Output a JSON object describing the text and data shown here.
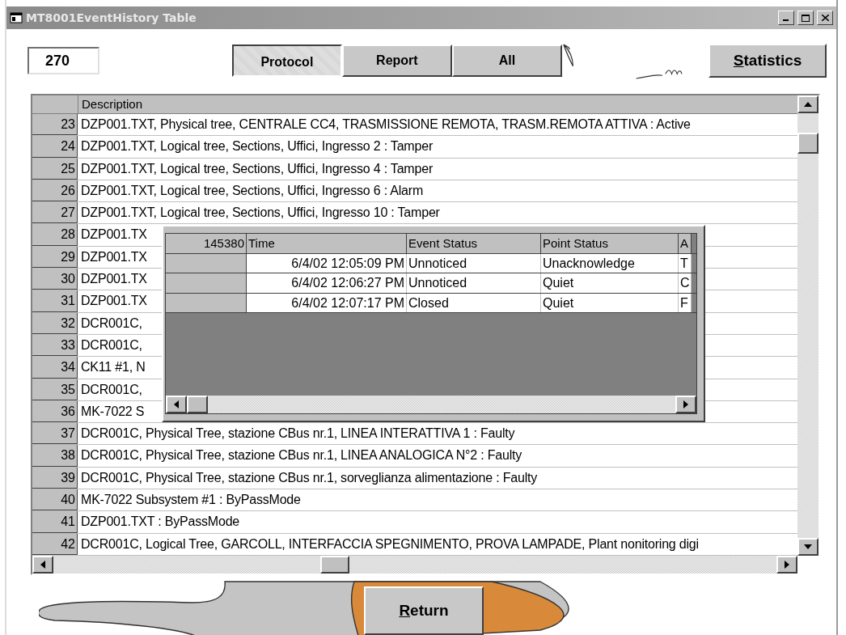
{
  "window": {
    "title": "MT8001EventHistory Table"
  },
  "counter": "270",
  "tabs": [
    {
      "label": "Protocol",
      "selected": true
    },
    {
      "label": "Report",
      "selected": false
    },
    {
      "label": "All",
      "selected": false
    }
  ],
  "statistics_button": {
    "label_parts": [
      {
        "text": "S",
        "underlined": true
      },
      {
        "text": "tatistics",
        "underlined": false
      }
    ]
  },
  "table": {
    "columns": [
      "Description"
    ],
    "rows": [
      {
        "number": "23",
        "description": "DZP001.TXT, Physical tree, CENTRALE CC4, TRASMISSIONE REMOTA, TRASM.REMOTA ATTIVA : Active"
      },
      {
        "number": "24",
        "description": "DZP001.TXT, Logical tree, Sections, Uffici, Ingresso 2 : Tamper"
      },
      {
        "number": "25",
        "description": "DZP001.TXT, Logical tree, Sections, Uffici, Ingresso 4 : Tamper"
      },
      {
        "number": "26",
        "description": "DZP001.TXT, Logical tree, Sections, Uffici, Ingresso 6 : Alarm"
      },
      {
        "number": "27",
        "description": "DZP001.TXT, Logical tree, Sections, Uffici, Ingresso 10 : Tamper"
      },
      {
        "number": "28",
        "description": "DZP001.TX"
      },
      {
        "number": "29",
        "description": "DZP001.TX"
      },
      {
        "number": "30",
        "description": "DZP001.TX"
      },
      {
        "number": "31",
        "description": "DZP001.TX"
      },
      {
        "number": "32",
        "description": "DCR001C,"
      },
      {
        "number": "33",
        "description": "DCR001C,"
      },
      {
        "number": "34",
        "description": "CK11 #1, N"
      },
      {
        "number": "35",
        "description": "DCR001C,"
      },
      {
        "number": "36",
        "description": "MK-7022 S"
      },
      {
        "number": "37",
        "description": "DCR001C, Physical Tree, stazione CBus nr.1, LINEA INTERATTIVA 1 : Faulty"
      },
      {
        "number": "38",
        "description": "DCR001C, Physical Tree, stazione CBus nr.1, LINEA ANALOGICA N°2 : Faulty"
      },
      {
        "number": "39",
        "description": "DCR001C, Physical Tree, stazione CBus nr.1, sorveglianza alimentazione : Faulty"
      },
      {
        "number": "40",
        "description": "MK-7022 Subsystem #1 : ByPassMode"
      },
      {
        "number": "41",
        "description": "DZP001.TXT : ByPassMode"
      },
      {
        "number": "42",
        "description": "DCR001C, Logical Tree, GARCOLL, INTERFACCIA SPEGNIMENTO, PROVA LAMPADE, Plant nonitoring digi"
      }
    ]
  },
  "detail_popup": {
    "corner": "145380",
    "columns": [
      "Time",
      "Event Status",
      "Point Status",
      "A"
    ],
    "rows": [
      {
        "time": "6/4/02 12:05:09 PM",
        "event_status": "Unnoticed",
        "point_status": "Unacknowledge",
        "column_4": "T"
      },
      {
        "time": "6/4/02 12:06:27 PM",
        "event_status": "Unnoticed",
        "point_status": "Quiet",
        "column_4": "C"
      },
      {
        "time": "6/4/02 12:07:17 PM",
        "event_status": "Closed",
        "point_status": "Quiet",
        "column_4": "F"
      }
    ]
  },
  "return_button": {
    "label_parts": [
      {
        "text": "R",
        "underlined": true
      },
      {
        "text": "eturn",
        "underlined": false
      }
    ]
  }
}
